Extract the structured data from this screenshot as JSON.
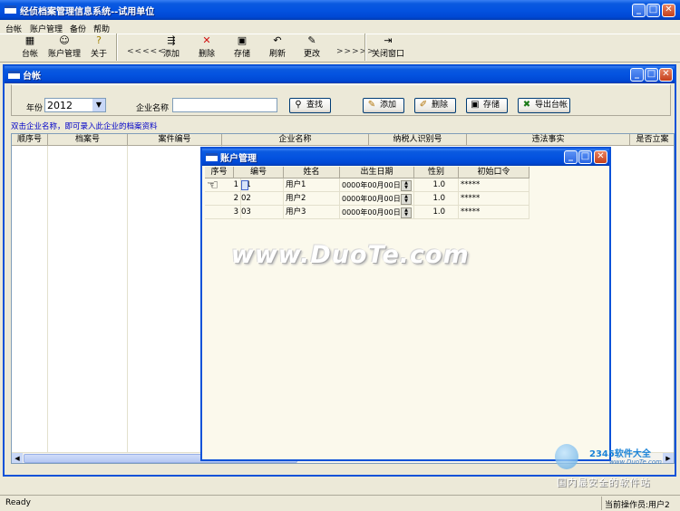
{
  "app": {
    "title": "经侦档案管理信息系统--试用单位"
  },
  "menu": [
    "台帐",
    "账户管理",
    "备份",
    "帮助"
  ],
  "toolbar": {
    "taizhang": "台帐",
    "account": "账户管理",
    "about": "关于",
    "prev": "<<<<<",
    "add": "添加",
    "delete": "删除",
    "save": "存储",
    "refresh": "刷新",
    "edit": "更改",
    "next": ">>>>>",
    "close_window": "关闭窗口"
  },
  "ledger_window": {
    "title": "台帐",
    "year_label": "年份",
    "year_value": "2012",
    "company_label": "企业名称",
    "company_value": "",
    "buttons": {
      "search": "查找",
      "add": "添加",
      "delete": "删除",
      "save": "存储",
      "export": "导出台帐"
    },
    "hint": "双击企业名称，即可录入此企业的档案资料",
    "columns": [
      "顺序号",
      "档案号",
      "案件编号",
      "企业名称",
      "纳税人识别号",
      "违法事实",
      "是否立案"
    ]
  },
  "account_window": {
    "title": "账户管理",
    "columns": [
      "序号",
      "编号",
      "姓名",
      "出生日期",
      "性别",
      "初始口令"
    ],
    "rows": [
      {
        "seq": "1",
        "code": "01",
        "name": "用户1",
        "birth": "0000年00月00日",
        "gender": "1.0",
        "pwd": "*****"
      },
      {
        "seq": "2",
        "code": "02",
        "name": "用户2",
        "birth": "0000年00月00日",
        "gender": "1.0",
        "pwd": "*****"
      },
      {
        "seq": "3",
        "code": "03",
        "name": "用户3",
        "birth": "0000年00月00日",
        "gender": "1.0",
        "pwd": "*****"
      }
    ]
  },
  "watermark": "www.DuoTe.com",
  "logo": {
    "brand": "2345软件大全",
    "url": "www.DuoTe.com",
    "slogan": "国内最安全的软件站"
  },
  "status": {
    "left": "Ready",
    "right": "当前操作员:用户2"
  }
}
